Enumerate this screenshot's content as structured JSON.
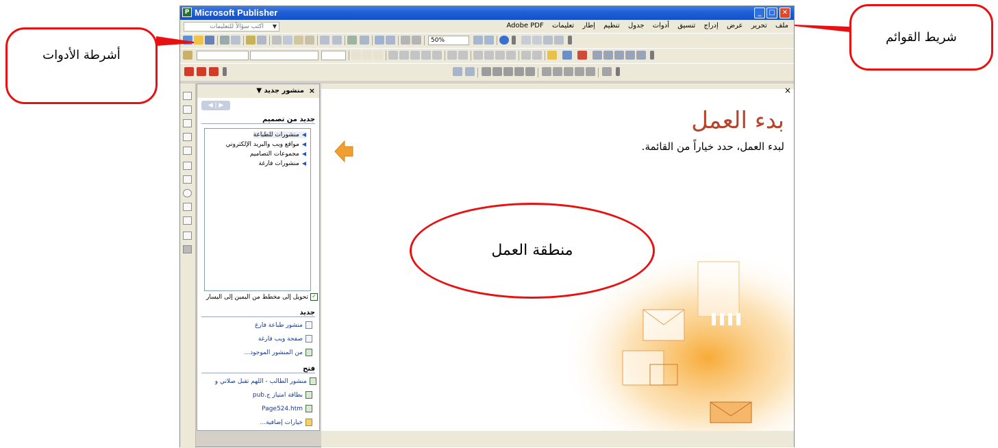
{
  "window": {
    "title": "Microsoft Publisher",
    "buttons": {
      "minimize": "_",
      "maximize": "□",
      "close": "✕"
    }
  },
  "help_box": {
    "placeholder": "اكتب سؤالاً للتعليمات"
  },
  "menu": [
    "ملف",
    "تحرير",
    "عرض",
    "إدراج",
    "تنسيق",
    "أدوات",
    "جدول",
    "تنظيم",
    "إطار",
    "تعليمات",
    "Adobe PDF"
  ],
  "toolbar": {
    "zoom": "50%"
  },
  "task_pane": {
    "title": "منشور جديد",
    "close": "×",
    "design_section_title": "جديد من تصميم",
    "design_items": [
      "منشورات للطباعة",
      "مواقع ويب والبريد الإلكتروني",
      "مجموعات التصاميم",
      "منشورات فارغة"
    ],
    "rtl_checkbox_label": "تحويل إلى مخطط من اليمين إلى اليسار",
    "new_section_title": "جديد",
    "new_items": [
      "منشور طباعة فارغ",
      "صفحة ويب فارغة",
      "من المنشور الموجود..."
    ],
    "open_section_title": "فتح",
    "open_items": [
      "منشور الطالب - اللهم تقبل صلاتي و",
      "بطاقة امتياز ج.pub",
      "Page524.htm",
      "خيارات إضافية..."
    ]
  },
  "work_area": {
    "close": "×",
    "title": "بدء العمل",
    "subtitle": "لبدء العمل، حدد خياراً من القائمة."
  },
  "callouts": {
    "menu_bar": "شريط القوائم",
    "toolbars": "أشرطة الأدوات",
    "work_area": "منطقة العمل"
  },
  "colors": {
    "title_bar": "#1e5fd6",
    "callout_border": "#e81010",
    "start_title": "#b5442a",
    "arrow": "#f0a030"
  }
}
